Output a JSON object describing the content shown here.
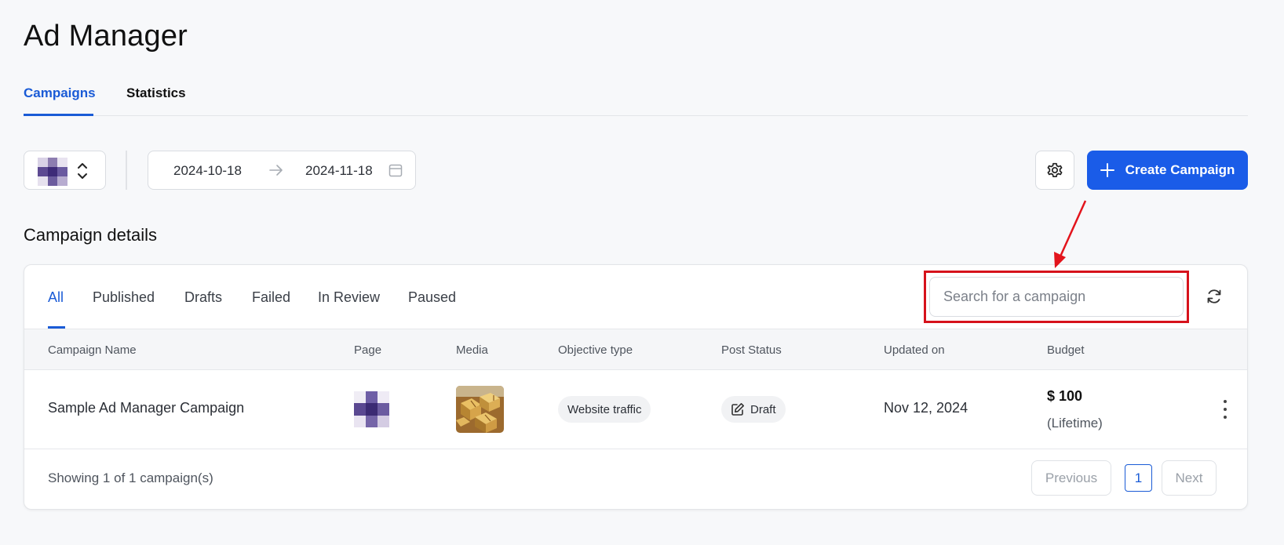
{
  "app": {
    "title": "Ad Manager"
  },
  "nav": {
    "tabs": [
      {
        "label": "Campaigns",
        "active": true
      },
      {
        "label": "Statistics",
        "active": false
      }
    ]
  },
  "toolbar": {
    "page_selector_icon": "pixelated-avatar",
    "date_start": "2024-10-18",
    "date_end": "2024-11-18",
    "settings_icon": "gear-icon",
    "create_label": "Create Campaign"
  },
  "section": {
    "title": "Campaign details"
  },
  "filters": [
    "All",
    "Published",
    "Drafts",
    "Failed",
    "In Review",
    "Paused"
  ],
  "active_filter": "All",
  "search": {
    "placeholder": "Search for a campaign",
    "value": ""
  },
  "table": {
    "columns": [
      "Campaign Name",
      "Page",
      "Media",
      "Objective type",
      "Post Status",
      "Updated on",
      "Budget"
    ],
    "rows": [
      {
        "name": "Sample Ad Manager Campaign",
        "page": "pixelated-avatar",
        "media": "gift-boxes-thumbnail",
        "objective": "Website traffic",
        "status": "Draft",
        "updated": "Nov 12, 2024",
        "budget": "$ 100",
        "budget_type": "(Lifetime)"
      }
    ]
  },
  "footer": {
    "showing": "Showing 1 of 1 campaign(s)",
    "prev_label": "Previous",
    "page": "1",
    "next_label": "Next"
  },
  "colors": {
    "accent": "#1a5ce8",
    "annotation": "#d6121b"
  }
}
